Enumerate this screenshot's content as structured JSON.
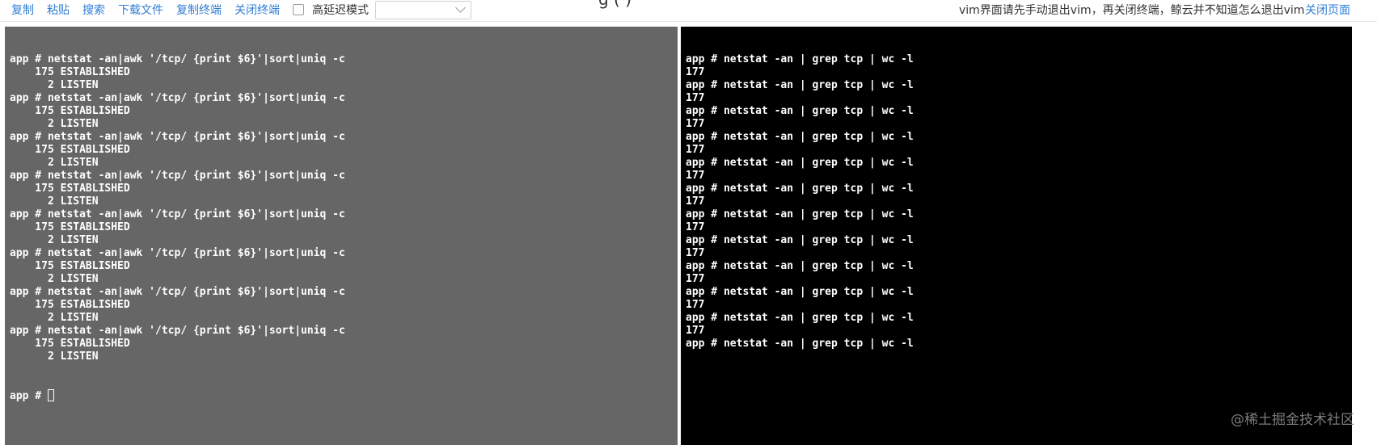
{
  "toolbar": {
    "copy": "复制",
    "paste": "粘贴",
    "search": "搜索",
    "download": "下载文件",
    "copy_terminal": "复制终端",
    "close_terminal": "关闭终端",
    "high_latency_label": "高延迟模式",
    "high_latency_checked": false,
    "select_value": "",
    "title": "g (                    )",
    "notice": "vim界面请先手动退出vim，再关闭终端，鲸云并不知道怎么退出vim",
    "close_page": "关闭页面"
  },
  "left_terminal": {
    "lines": [
      "app # netstat -an|awk '/tcp/ {print $6}'|sort|uniq -c",
      "    175 ESTABLISHED",
      "      2 LISTEN",
      "app # netstat -an|awk '/tcp/ {print $6}'|sort|uniq -c",
      "    175 ESTABLISHED",
      "      2 LISTEN",
      "app # netstat -an|awk '/tcp/ {print $6}'|sort|uniq -c",
      "    175 ESTABLISHED",
      "      2 LISTEN",
      "app # netstat -an|awk '/tcp/ {print $6}'|sort|uniq -c",
      "    175 ESTABLISHED",
      "      2 LISTEN",
      "app # netstat -an|awk '/tcp/ {print $6}'|sort|uniq -c",
      "    175 ESTABLISHED",
      "      2 LISTEN",
      "app # netstat -an|awk '/tcp/ {print $6}'|sort|uniq -c",
      "    175 ESTABLISHED",
      "      2 LISTEN",
      "app # netstat -an|awk '/tcp/ {print $6}'|sort|uniq -c",
      "    175 ESTABLISHED",
      "      2 LISTEN",
      "app # netstat -an|awk '/tcp/ {print $6}'|sort|uniq -c",
      "    175 ESTABLISHED",
      "      2 LISTEN"
    ],
    "prompt": "app # "
  },
  "right_terminal": {
    "lines": [
      "app # netstat -an | grep tcp | wc -l",
      "177",
      "app # netstat -an | grep tcp | wc -l",
      "177",
      "app # netstat -an | grep tcp | wc -l",
      "177",
      "app # netstat -an | grep tcp | wc -l",
      "177",
      "app # netstat -an | grep tcp | wc -l",
      "177",
      "app # netstat -an | grep tcp | wc -l",
      "177",
      "app # netstat -an | grep tcp | wc -l",
      "177",
      "app # netstat -an | grep tcp | wc -l",
      "177",
      "app # netstat -an | grep tcp | wc -l",
      "177",
      "app # netstat -an | grep tcp | wc -l",
      "177",
      "app # netstat -an | grep tcp | wc -l",
      "177",
      "app # netstat -an | grep tcp | wc -l"
    ]
  },
  "watermark": "@稀土掘金技术社区",
  "colors": {
    "link": "#2f7dd6",
    "left_terminal_bg": "#666666",
    "right_terminal_bg": "#000000",
    "terminal_fg": "#ffffff"
  },
  "icons": {
    "select_arrow": "chevron-down-icon",
    "cursor": "terminal-cursor"
  }
}
